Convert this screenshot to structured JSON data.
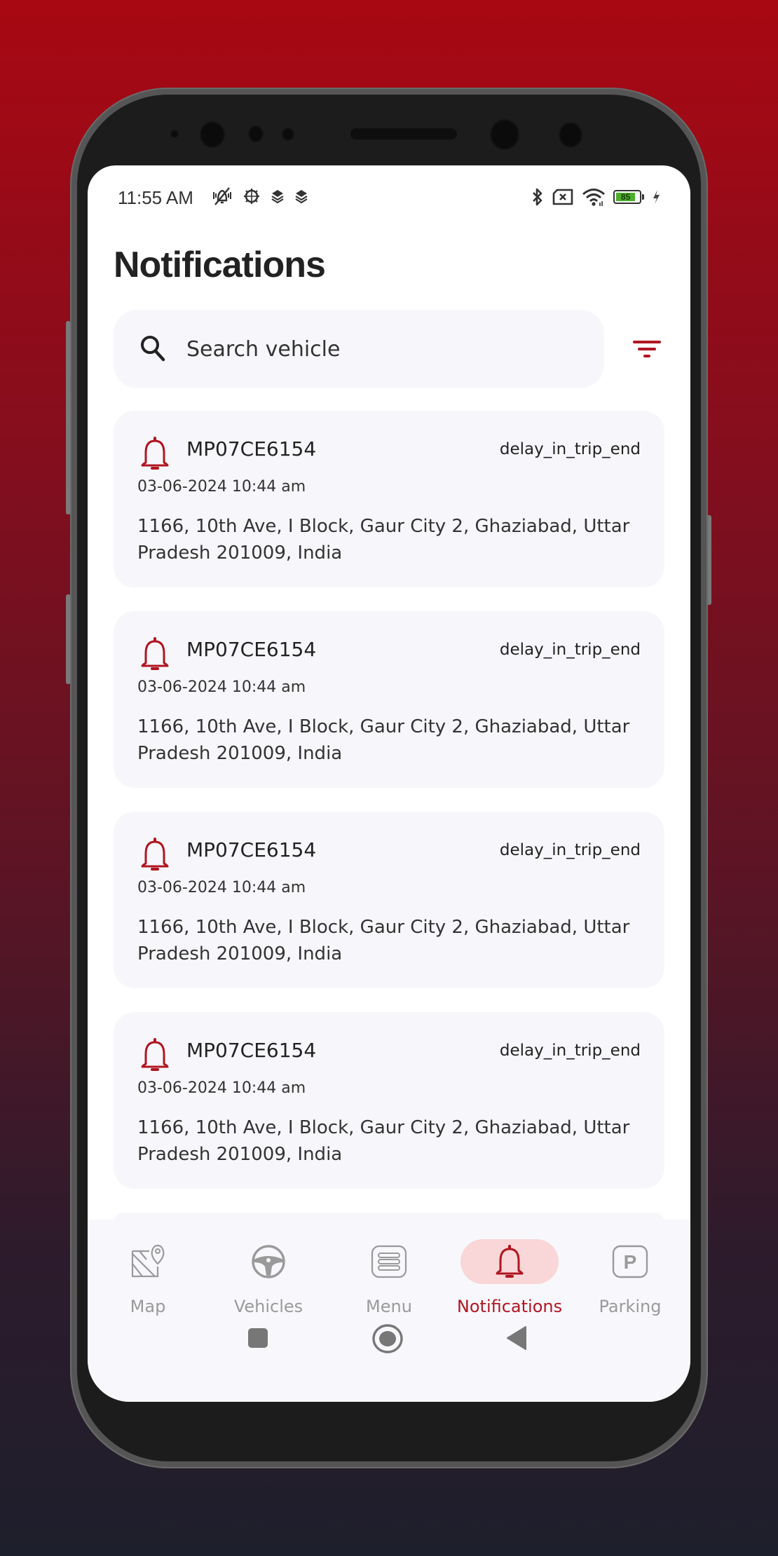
{
  "status_bar": {
    "time": "11:55 AM",
    "left_icons": [
      "vibrate-off-icon",
      "android-debug-icon",
      "layers-icon",
      "layers-icon"
    ],
    "right_icons": [
      "bluetooth-icon",
      "sim-x-icon",
      "wifi-icon"
    ],
    "battery_level": "85",
    "charging": true
  },
  "header": {
    "title": "Notifications"
  },
  "search": {
    "placeholder": "Search vehicle",
    "value": ""
  },
  "filter": {
    "icon": "filter-icon"
  },
  "notifications": [
    {
      "vehicle": "MP07CE6154",
      "type": "delay_in_trip_end",
      "datetime": "03-06-2024 10:44 am",
      "address": "1166, 10th Ave, I Block, Gaur City 2, Ghaziabad, Uttar Pradesh 201009, India"
    },
    {
      "vehicle": "MP07CE6154",
      "type": "delay_in_trip_end",
      "datetime": "03-06-2024 10:44 am",
      "address": "1166, 10th Ave, I Block, Gaur City 2, Ghaziabad, Uttar Pradesh 201009, India"
    },
    {
      "vehicle": "MP07CE6154",
      "type": "delay_in_trip_end",
      "datetime": "03-06-2024 10:44 am",
      "address": "1166, 10th Ave, I Block, Gaur City 2, Ghaziabad, Uttar Pradesh 201009, India"
    },
    {
      "vehicle": "MP07CE6154",
      "type": "delay_in_trip_end",
      "datetime": "03-06-2024 10:44 am",
      "address": "1166, 10th Ave, I Block, Gaur City 2, Ghaziabad, Uttar Pradesh 201009, India"
    }
  ],
  "bottom_nav": {
    "items": [
      {
        "label": "Map",
        "icon": "map-icon",
        "active": false
      },
      {
        "label": "Vehicles",
        "icon": "steering-wheel-icon",
        "active": false
      },
      {
        "label": "Menu",
        "icon": "menu-icon",
        "active": false
      },
      {
        "label": "Notifications",
        "icon": "bell-icon",
        "active": true
      },
      {
        "label": "Parking",
        "icon": "parking-icon",
        "active": false
      }
    ]
  },
  "system_nav": {
    "buttons": [
      "recents",
      "home",
      "back"
    ]
  },
  "colors": {
    "accent": "#b01622",
    "accent_light": "#f9d6d7",
    "card_bg": "#f7f7fb",
    "inactive": "#9a9a9a"
  }
}
